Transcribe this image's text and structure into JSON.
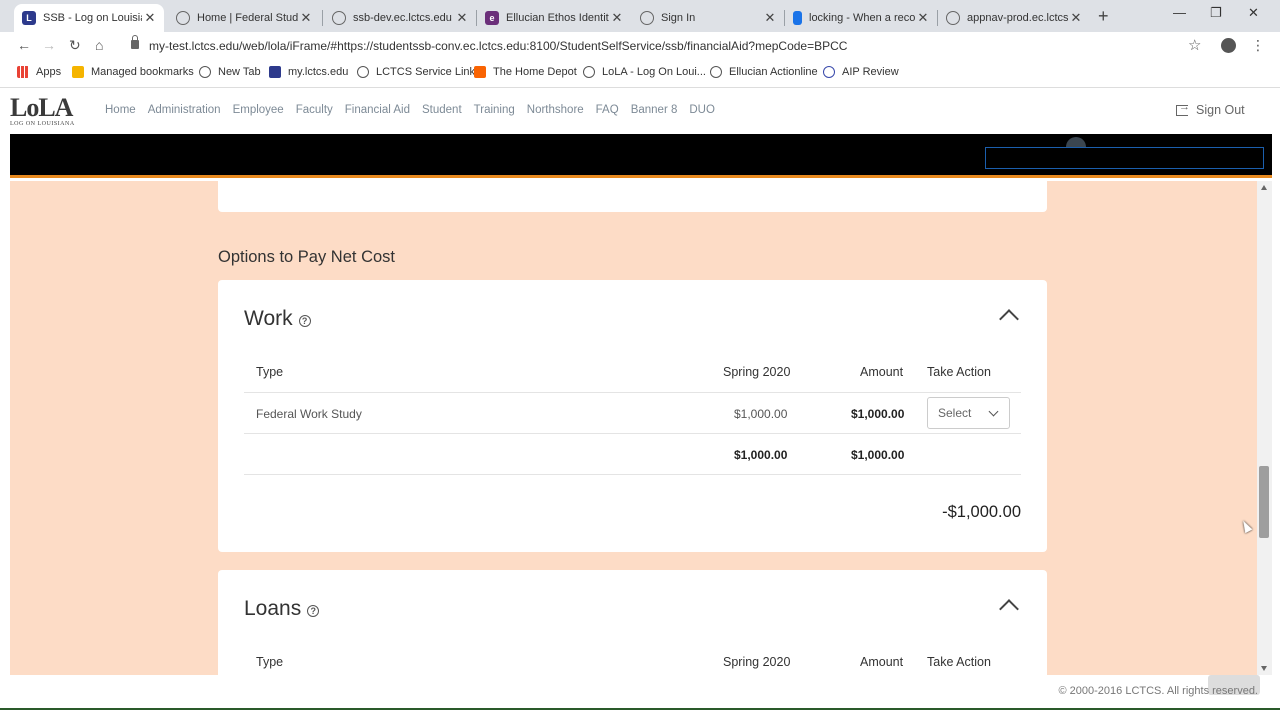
{
  "browser": {
    "tabs": [
      {
        "title": "SSB - Log on Louisiana",
        "active": true,
        "icon": "lola-favicon"
      },
      {
        "title": "Home | Federal Student",
        "active": false,
        "icon": "globe-icon"
      },
      {
        "title": "ssb-dev.ec.lctcs.edu",
        "active": false,
        "icon": "globe-icon"
      },
      {
        "title": "Ellucian Ethos Identity",
        "active": false,
        "icon": "ellucian-favicon"
      },
      {
        "title": "Sign In",
        "active": false,
        "icon": "globe-icon"
      },
      {
        "title": "locking - When a reco",
        "active": false,
        "icon": "doc-favicon"
      },
      {
        "title": "appnav-prod.ec.lctcs.e",
        "active": false,
        "icon": "globe-icon"
      }
    ],
    "url": "my-test.lctcs.edu/web/lola/iFrame/#https://studentssb-conv.ec.lctcs.edu:8100/StudentSelfService/ssb/financialAid?mepCode=BPCC",
    "bookmarks": [
      {
        "label": "Apps",
        "icon": "apps-grid-icon"
      },
      {
        "label": "Managed bookmarks",
        "icon": "folder-icon"
      },
      {
        "label": "New Tab",
        "icon": "globe-icon"
      },
      {
        "label": "my.lctcs.edu",
        "icon": "lola-favicon"
      },
      {
        "label": "LCTCS Service Links",
        "icon": "globe-icon"
      },
      {
        "label": "The Home Depot",
        "icon": "homedepot-favicon"
      },
      {
        "label": "LoLA - Log On Loui...",
        "icon": "globe-icon"
      },
      {
        "label": "Ellucian Actionline",
        "icon": "globe-icon"
      },
      {
        "label": "AIP Review",
        "icon": "aip-favicon"
      }
    ]
  },
  "header": {
    "logo_text": "LoLA",
    "logo_subtext": "LOG ON LOUISIANA",
    "nav": [
      "Home",
      "Administration",
      "Employee",
      "Faculty",
      "Financial Aid",
      "Student",
      "Training",
      "Northshore",
      "FAQ",
      "Banner 8",
      "DUO"
    ],
    "sign_out": "Sign Out"
  },
  "main": {
    "section_title": "Options to Pay Net Cost",
    "work": {
      "title": "Work",
      "columns": [
        "Type",
        "Spring 2020",
        "Amount",
        "Take Action"
      ],
      "rows": [
        {
          "type": "Federal Work Study",
          "term": "$1,000.00",
          "amount": "$1,000.00",
          "action": "Select"
        }
      ],
      "totals": {
        "term": "$1,000.00",
        "amount": "$1,000.00"
      },
      "net": "-$1,000.00"
    },
    "loans": {
      "title": "Loans",
      "columns": [
        "Type",
        "Spring 2020",
        "Amount",
        "Take Action"
      ]
    }
  },
  "footer": {
    "copyright": "© 2000-2016 LCTCS. All rights reserved."
  },
  "colors": {
    "page_bg": "#fddcc6",
    "accent_bar": "#e88a1f",
    "nav_text": "#7d8a96"
  }
}
